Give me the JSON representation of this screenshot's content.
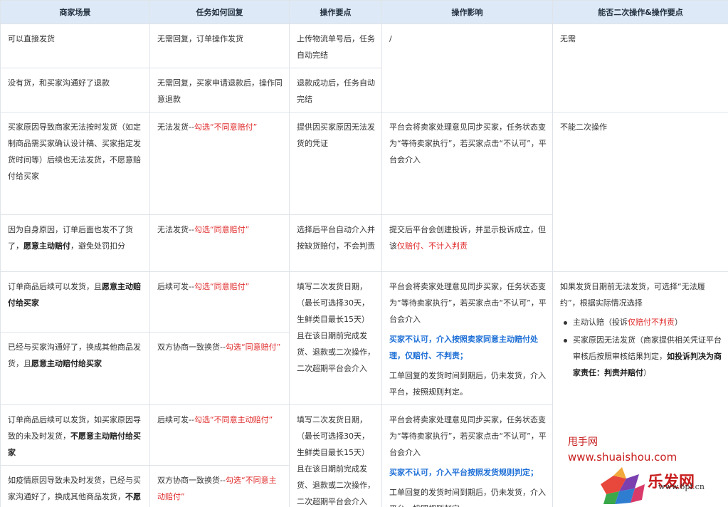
{
  "headers": [
    "商家场景",
    "任务如何回复",
    "操作要点",
    "操作影响",
    "能否二次操作&操作要点"
  ],
  "r1": {
    "scene": "可以直接发货",
    "reply": "无需回复，订单操作发货",
    "points": "上传物流单号后，任务自动完结",
    "impact": "/",
    "second": "无需"
  },
  "r2": {
    "scene": "没有货，和买家沟通好了退款",
    "reply": "无需回复，买家申请退款后，操作同意退款",
    "points": "退款成功后，任务自动完结"
  },
  "r3": {
    "scene": "买家原因导致商家无法按时发货（如定制商品需买家确认设计稿、买家指定发货时间等）后续也无法发货，不愿意赔付给买家",
    "reply_a": "无法发货--",
    "reply_b": "勾选“不同意赔付”",
    "points": "提供因买家原因无法发货的凭证",
    "impact": "平台会将卖家处理意见同步买家，任务状态变为“等待卖家执行”，若买家点击“不认可”，平台会介入",
    "second": "不能二次操作"
  },
  "r4": {
    "scene_a": "因为自身原因，订单后面也发不了货了，",
    "scene_b": "愿意主动赔付",
    "scene_c": "，避免处罚扣分",
    "reply_a": "无法发货--",
    "reply_b": "勾选“同意赔付”",
    "points": "选择后平台自动介入并按缺货赔付，不会判责",
    "impact_a": "提交后平台会创建投诉，并显示投诉成立，但该",
    "impact_b": "仅赔付、不计入判责"
  },
  "r5": {
    "scene_a": "订单商品后续可以发货，且",
    "scene_b": "愿意主动赔付给买家",
    "reply_a": "后续可发--",
    "reply_b": "勾选“同意赔付”"
  },
  "r6": {
    "scene_a": "已经与买家沟通好了，换成其他商品发货，且",
    "scene_b": "愿意主动赔付给买家",
    "reply_a": "双方协商一致换货--",
    "reply_b": "勾选“同意赔付”"
  },
  "g1": {
    "points": "填写二次发货日期，（最长可选择30天，生鲜类目最长15天）且在该日期前完成发货、退款或二次操作，二次超期平台会介入",
    "impact_a": "平台会将卖家处理意见同步买家，任务状态变为“等待卖家执行”，若买家点击“不认可”，平台会介入",
    "impact_b": "买家不认可，介入按照卖家同意主动赔付处理，仅赔付、不判责；",
    "impact_c": "工单回复的发货时间到期后，仍未发货，介入平台，按照规则判定。",
    "second_intro": "如果发货日期前无法发货，可选择“无法履约”，根据实际情况选择",
    "opt1_a": "主动认赔（投诉",
    "opt1_b": "仅赔付不判责",
    "opt1_c": "）",
    "opt2_a": "买家原因无法发货（商家提供相关凭证平台审核后按照审核结果判定，",
    "opt2_b": "如投诉判决为商家责任：判责并赔付",
    "opt2_c": "）"
  },
  "r7": {
    "scene_a": "订单商品后续可以发货，如买家原因导致的未及时发货，",
    "scene_b": "不愿意主动赔付给买家",
    "reply_a": "后续可发--",
    "reply_b": "勾选“不同意主动赔付”"
  },
  "r8": {
    "scene_a": "如疫情原因导致未及时发货，已经与买家沟通好了，换成其他商品发货，",
    "scene_b": "不愿意主动赔付买家",
    "reply_a": "双方协商一致换货--",
    "reply_b": "勾选“不同意主动赔付”"
  },
  "g2": {
    "points": "填写二次发货日期，（最长可选择30天，生鲜类目最长15天）且在该日期前完成发货、退款或二次操作，二次超期平台会介入",
    "impact_a": "平台会将卖家处理意见同步买家，任务状态变为“等待卖家执行”，若买家点击“不认可”，平台会介入",
    "impact_b": "买家不认可，介入平台按照发货规则判定；",
    "impact_c": "工单回复的发货时间到期后，仍未发货，介入平台，按照规则判定。"
  },
  "watermark": {
    "line1": "甩手网",
    "line2": "www.shuaishou.com",
    "logo_text": "乐发网",
    "logo_url": "www.6pf.cn"
  }
}
